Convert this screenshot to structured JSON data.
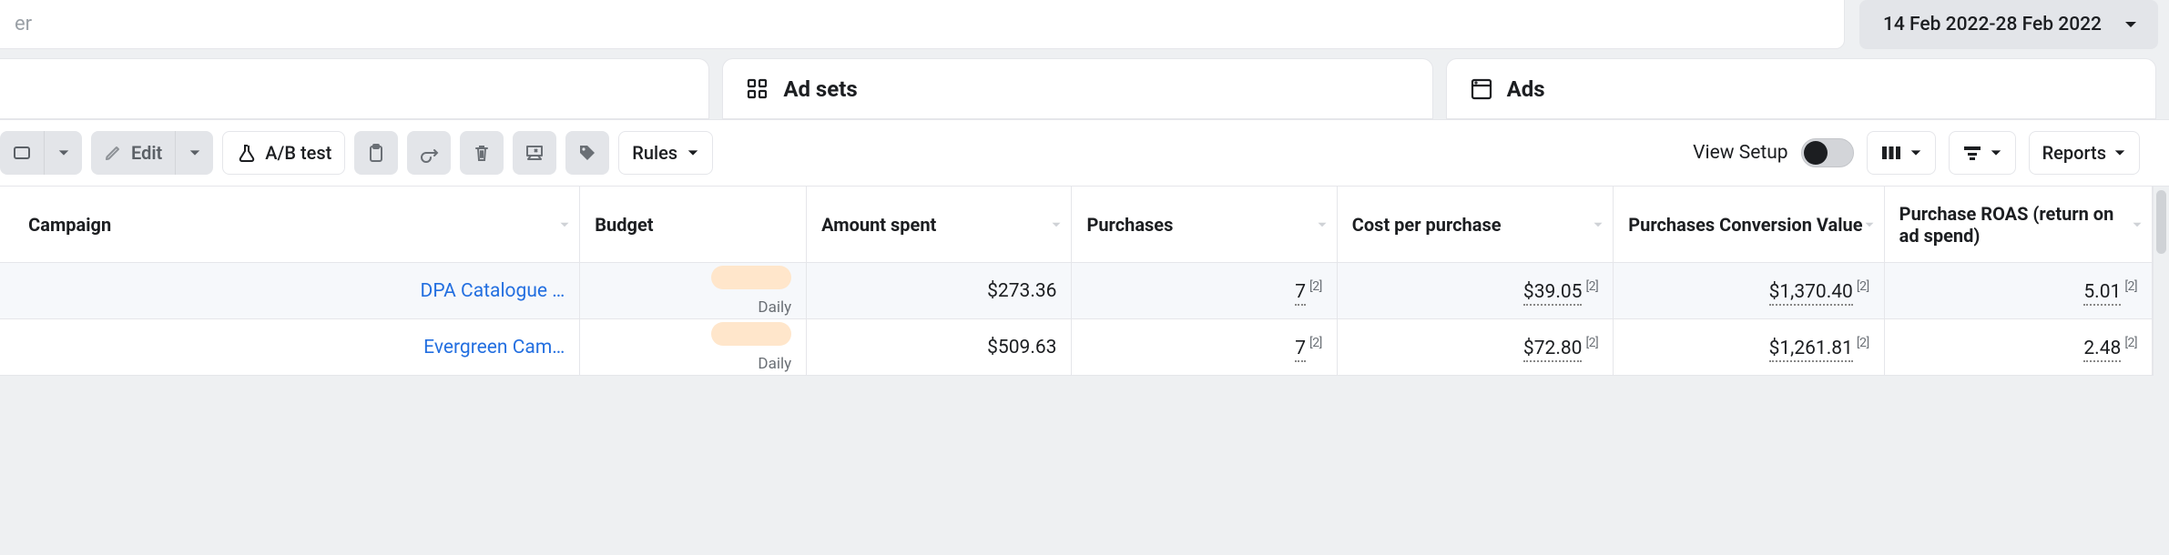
{
  "search": {
    "placeholder_fragment": "er"
  },
  "date_range": {
    "label": "14 Feb 2022-28 Feb 2022"
  },
  "tabs": {
    "campaigns": {
      "label": ""
    },
    "adsets": {
      "label": "Ad sets"
    },
    "ads": {
      "label": "Ads"
    }
  },
  "toolbar": {
    "edit": "Edit",
    "abtest": "A/B test",
    "rules": "Rules",
    "view_setup": "View Setup",
    "reports": "Reports"
  },
  "columns": {
    "campaign": "Campaign",
    "budget": "Budget",
    "amount_spent": "Amount spent",
    "purchases": "Purchases",
    "cost_per_purchase": "Cost per purchase",
    "purchases_conversion_value": "Purchases Conversion Value",
    "roas": "Purchase ROAS (return on ad spend)"
  },
  "budget_period": "Daily",
  "footnote": "[2]",
  "rows": [
    {
      "campaign": "DPA Catalogue …",
      "amount_spent": "$273.36",
      "purchases": "7",
      "cost_per_purchase": "$39.05",
      "pcv": "$1,370.40",
      "roas": "5.01"
    },
    {
      "campaign": "Evergreen Cam…",
      "amount_spent": "$509.63",
      "purchases": "7",
      "cost_per_purchase": "$72.80",
      "pcv": "$1,261.81",
      "roas": "2.48"
    }
  ],
  "chart_data": {
    "type": "table",
    "title": "Campaign performance 14 Feb 2022 – 28 Feb 2022",
    "columns": [
      "Campaign",
      "Amount spent (USD)",
      "Purchases",
      "Cost per purchase (USD)",
      "Purchases Conversion Value (USD)",
      "Purchase ROAS"
    ],
    "rows": [
      [
        "DPA Catalogue",
        273.36,
        7,
        39.05,
        1370.4,
        5.01
      ],
      [
        "Evergreen Campaign",
        509.63,
        7,
        72.8,
        1261.81,
        2.48
      ]
    ]
  }
}
